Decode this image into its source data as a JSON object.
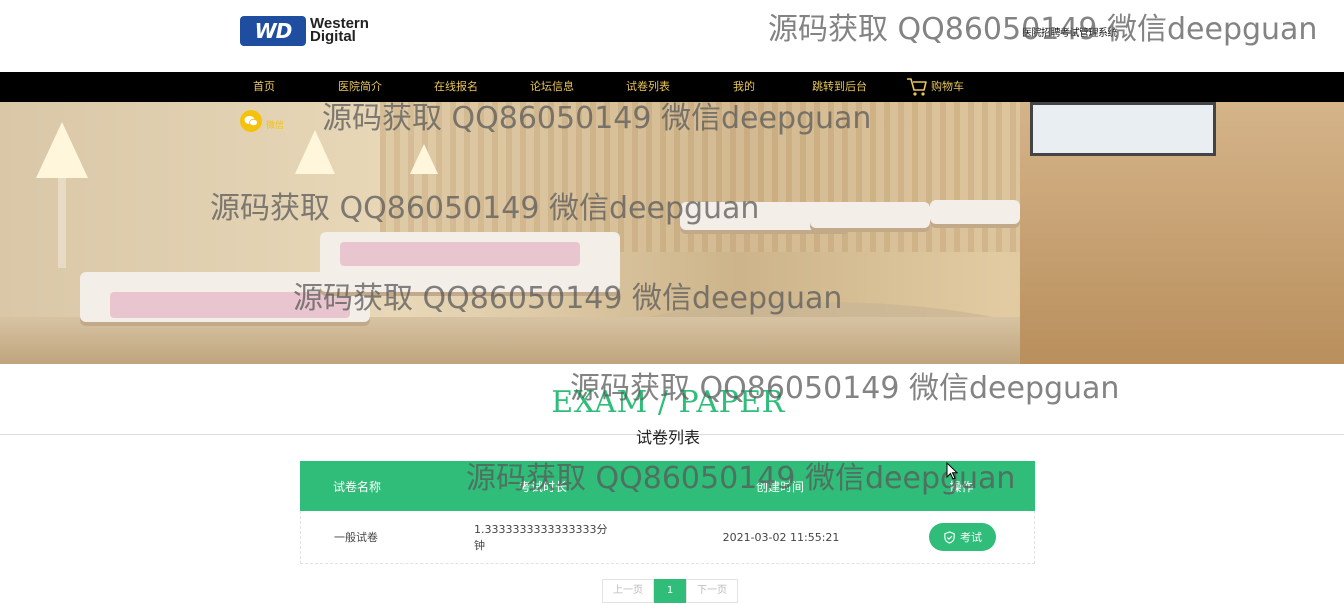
{
  "header": {
    "logo_line1": "Western",
    "logo_line2": "Digital",
    "logo_mark": "WD",
    "system_name": "医院招聘考试管理系统"
  },
  "nav": {
    "items": [
      "首页",
      "医院简介",
      "在线报名",
      "论坛信息",
      "试卷列表",
      "我的",
      "跳转到后台"
    ],
    "cart_label": "购物车",
    "cart_icon": "shopping-cart-icon"
  },
  "banner": {
    "wechat_icon": "wechat-icon",
    "wechat_label": "微信"
  },
  "section": {
    "title_en": "EXAM / PAPER",
    "title_cn": "试卷列表"
  },
  "table": {
    "headers": [
      "试卷名称",
      "考试时长",
      "创建时间",
      "操作"
    ],
    "rows": [
      {
        "name": "一般试卷",
        "duration": "1.3333333333333333分钟",
        "created": "2021-03-02 11:55:21",
        "action": "考试"
      }
    ]
  },
  "pagination": {
    "prev": "上一页",
    "current": "1",
    "next": "下一页"
  },
  "watermark": "源码获取 QQ86050149 微信deepguan",
  "colors": {
    "accent": "#2fbd79",
    "nav_bg": "#000000",
    "nav_text": "#e9c65a",
    "logo_blue": "#1f4ea0"
  }
}
